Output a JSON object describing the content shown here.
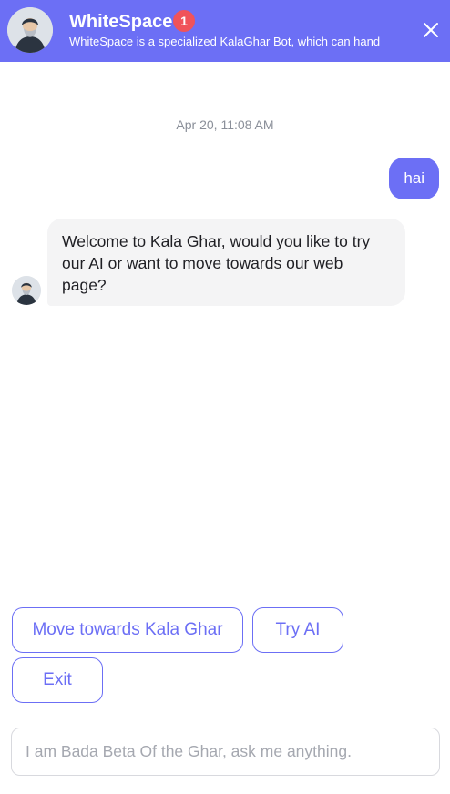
{
  "header": {
    "title": "WhiteSpace",
    "badge_count": "1",
    "subtitle": "WhiteSpace is a specialized KalaGhar Bot, which can hand",
    "avatar_icon": "bearded-man-avatar-icon",
    "close_icon": "close-icon",
    "background_color": "#6c6ff5"
  },
  "chat": {
    "timestamp": "Apr 20, 11:08 AM",
    "messages": [
      {
        "sender": "user",
        "text": "hai"
      },
      {
        "sender": "bot",
        "text": "Welcome to Kala Ghar, would you like to try our AI or want to move towards our web page?"
      }
    ]
  },
  "quick_replies": [
    {
      "label": "Move towards Kala Ghar"
    },
    {
      "label": "Try AI"
    },
    {
      "label": "Exit"
    }
  ],
  "input": {
    "placeholder": "I am Bada Beta Of the Ghar, ask me anything.",
    "value": ""
  },
  "colors": {
    "accent": "#6c6ff5",
    "badge": "#f0535a",
    "bot_bubble": "#f4f4f5"
  }
}
